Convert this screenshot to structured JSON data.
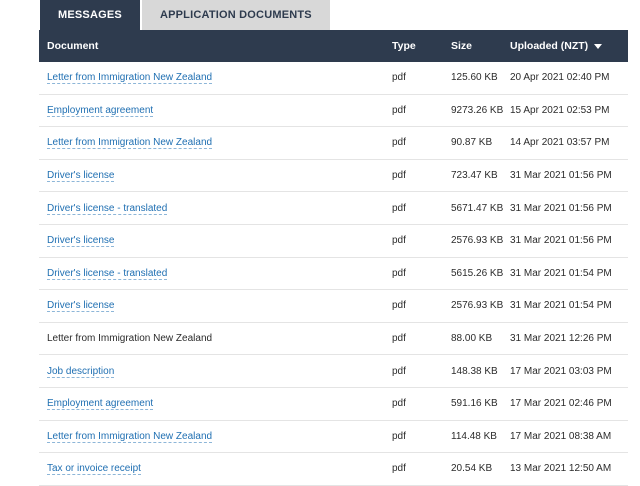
{
  "tabs": [
    {
      "label": "MESSAGES",
      "active": true
    },
    {
      "label": "APPLICATION DOCUMENTS",
      "active": false
    }
  ],
  "table": {
    "headers": {
      "document": "Document",
      "type": "Type",
      "size": "Size",
      "uploaded": "Uploaded (NZT)"
    },
    "rows": [
      {
        "document": "Letter from Immigration New Zealand",
        "link": true,
        "type": "pdf",
        "size": "125.60 KB",
        "uploaded": "20 Apr 2021 02:40 PM"
      },
      {
        "document": "Employment agreement",
        "link": true,
        "type": "pdf",
        "size": "9273.26 KB",
        "uploaded": "15 Apr 2021 02:53 PM"
      },
      {
        "document": "Letter from Immigration New Zealand",
        "link": true,
        "type": "pdf",
        "size": "90.87 KB",
        "uploaded": "14 Apr 2021 03:57 PM"
      },
      {
        "document": "Driver's license",
        "link": true,
        "type": "pdf",
        "size": "723.47 KB",
        "uploaded": "31 Mar 2021 01:56 PM"
      },
      {
        "document": "Driver's license - translated",
        "link": true,
        "type": "pdf",
        "size": "5671.47 KB",
        "uploaded": "31 Mar 2021 01:56 PM"
      },
      {
        "document": "Driver's license",
        "link": true,
        "type": "pdf",
        "size": "2576.93 KB",
        "uploaded": "31 Mar 2021 01:56 PM"
      },
      {
        "document": "Driver's license - translated",
        "link": true,
        "type": "pdf",
        "size": "5615.26 KB",
        "uploaded": "31 Mar 2021 01:54 PM"
      },
      {
        "document": "Driver's license",
        "link": true,
        "type": "pdf",
        "size": "2576.93 KB",
        "uploaded": "31 Mar 2021 01:54 PM"
      },
      {
        "document": "Letter from Immigration New Zealand",
        "link": false,
        "type": "pdf",
        "size": "88.00 KB",
        "uploaded": "31 Mar 2021 12:26 PM"
      },
      {
        "document": "Job description",
        "link": true,
        "type": "pdf",
        "size": "148.38 KB",
        "uploaded": "17 Mar 2021 03:03 PM"
      },
      {
        "document": "Employment agreement",
        "link": true,
        "type": "pdf",
        "size": "591.16 KB",
        "uploaded": "17 Mar 2021 02:46 PM"
      },
      {
        "document": "Letter from Immigration New Zealand",
        "link": true,
        "type": "pdf",
        "size": "114.48 KB",
        "uploaded": "17 Mar 2021 08:38 AM"
      },
      {
        "document": "Tax or invoice receipt",
        "link": true,
        "type": "pdf",
        "size": "20.54 KB",
        "uploaded": "13 Mar 2021 12:50 AM"
      }
    ]
  },
  "colors": {
    "header_bg": "#2e3b4e",
    "link": "#1f6fb2",
    "inactive_tab": "#d8d8d8"
  },
  "icons": {
    "sort": "caret-down-icon"
  }
}
